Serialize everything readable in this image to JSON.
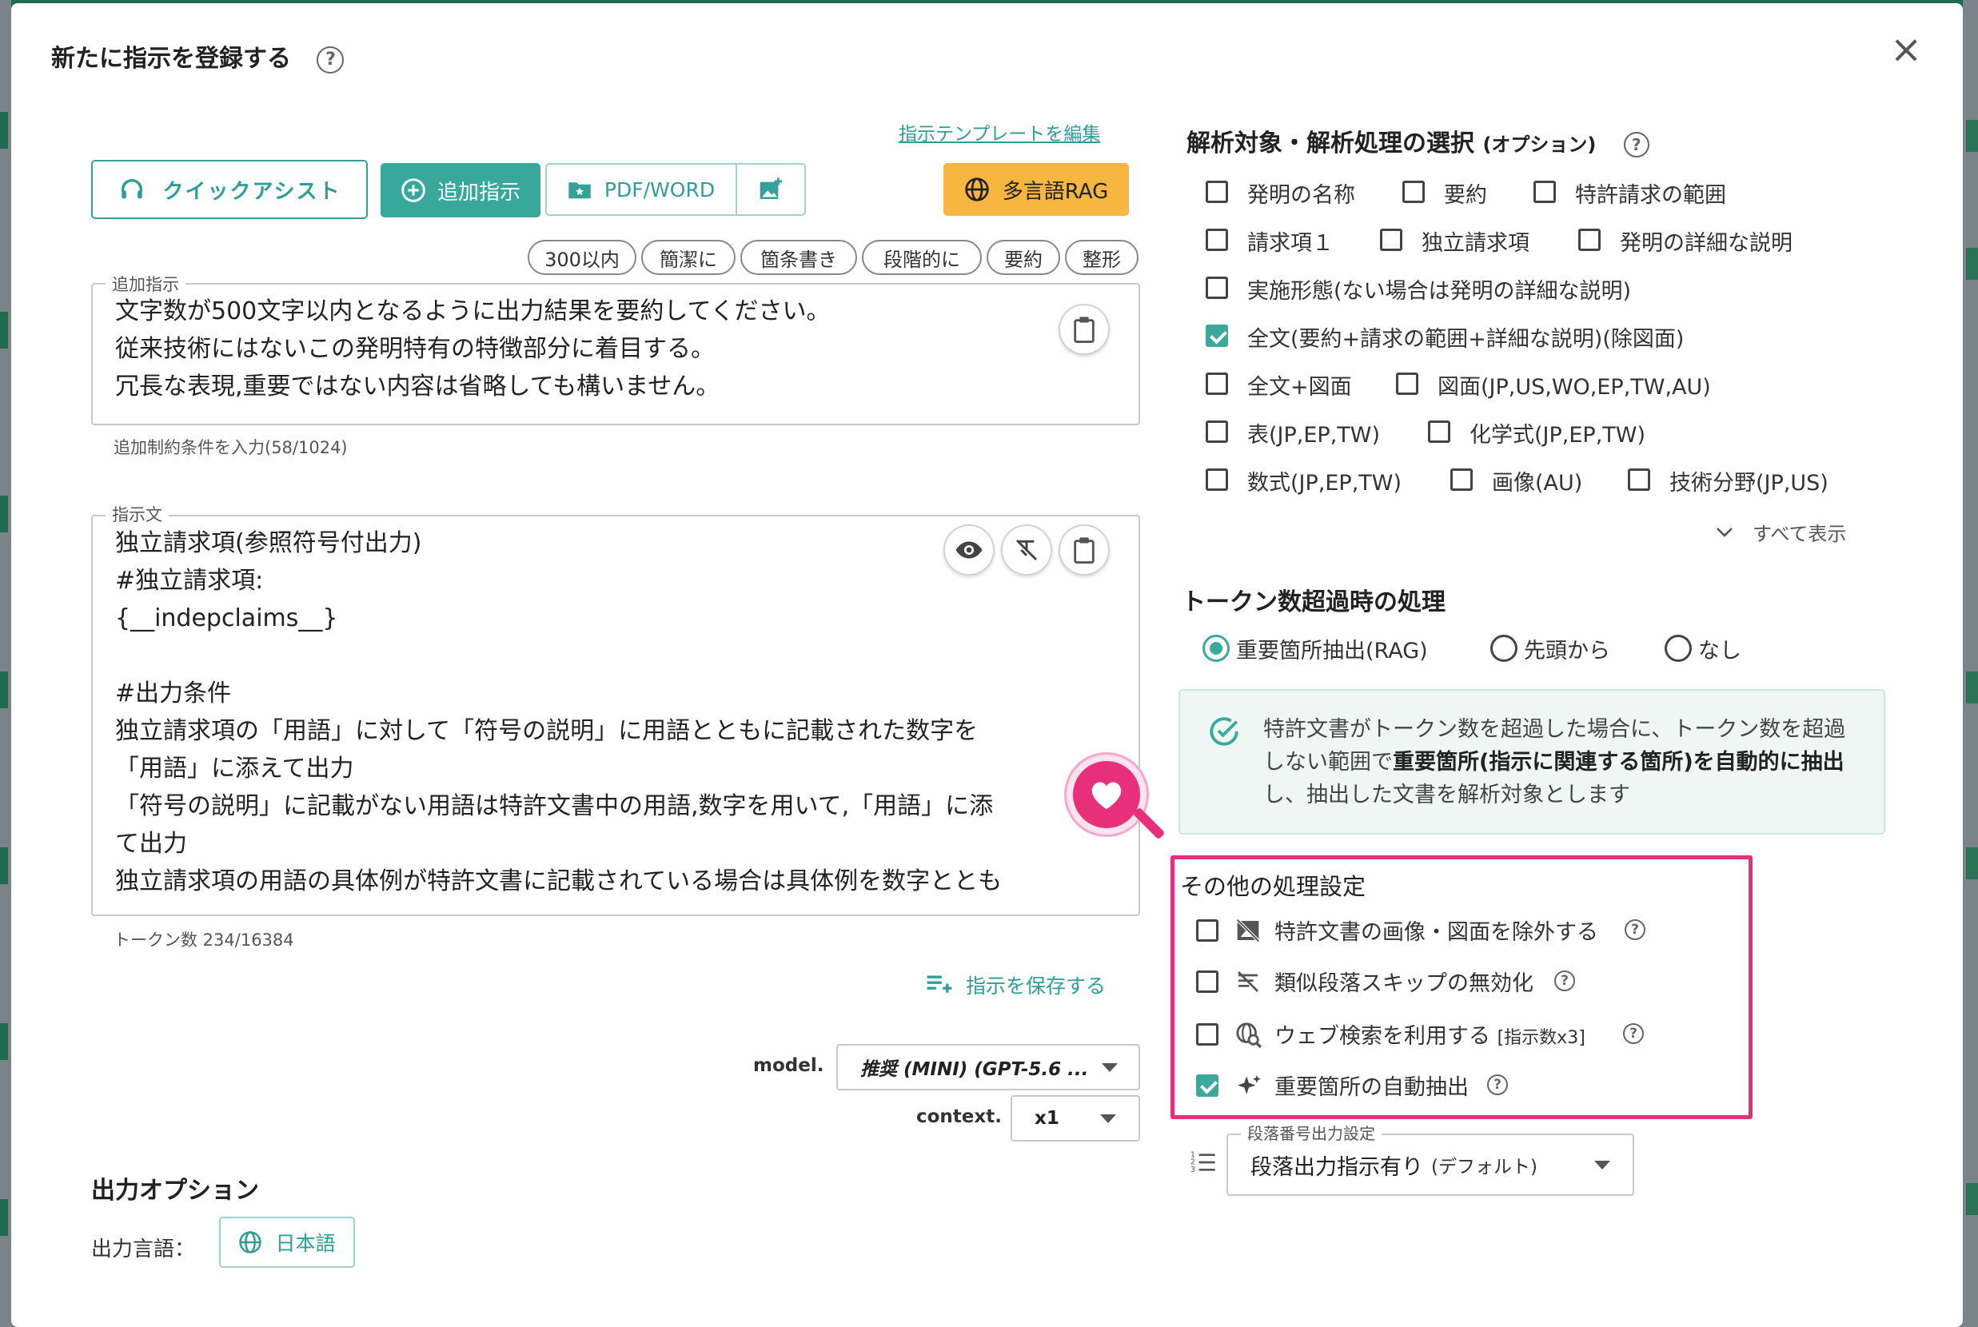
{
  "dialog": {
    "title": "新たに指示を登録する",
    "close_label": "×"
  },
  "left": {
    "edit_template_link": "指示テンプレートを編集",
    "quick_assist_label": "クイックアシスト",
    "add_instruction_label": "追加指示",
    "pdf_word_label": "PDF/WORD",
    "multilang_rag_label": "多言語RAG",
    "chips": [
      "300以内",
      "簡潔に",
      "箇条書き",
      "段階的に",
      "要約",
      "整形"
    ],
    "additional": {
      "label": "追加指示",
      "lines": [
        "文字数が500文字以内となるように出力結果を要約してください。",
        "従来技術にはないこの発明特有の特徴部分に着目する。",
        "冗長な表現,重要ではない内容は省略しても構いません。"
      ],
      "helper": "追加制約条件を入力(58/1024)"
    },
    "instruction": {
      "label": "指示文",
      "lines": [
        "独立請求項(参照符号付出力)",
        "#独立請求項:",
        "{__indepclaims__}",
        "",
        "#出力条件",
        "独立請求項の「用語」に対して「符号の説明」に用語とともに記載された数字を",
        "「用語」に添えて出力",
        "「符号の説明」に記載がない用語は特許文書中の用語,数字を用いて,「用語」に添",
        "て出力",
        "独立請求項の用語の具体例が特許文書に記載されている場合は具体例を数字ととも"
      ],
      "helper": "トークン数 234/16384"
    },
    "save_instruction_label": "指示を保存する",
    "model_label": "model.",
    "model_value": "推奨 (MINI) (GPT-5.6 ...",
    "context_label": "context.",
    "context_value": "x1",
    "output_options_title": "出力オプション",
    "output_language_label": "出力言語：",
    "output_language_value": "日本語"
  },
  "right": {
    "analysis_title": "解析対象・解析処理の選択",
    "analysis_title_suffix": "(オプション)",
    "targets": [
      {
        "label": "発明の名称",
        "checked": false
      },
      {
        "label": "要約",
        "checked": false
      },
      {
        "label": "特許請求の範囲",
        "checked": false
      },
      {
        "label": "請求項１",
        "checked": false
      },
      {
        "label": "独立請求項",
        "checked": false
      },
      {
        "label": "発明の詳細な説明",
        "checked": false
      },
      {
        "label": "実施形態(ない場合は発明の詳細な説明)",
        "checked": false
      },
      {
        "label": "全文(要約+請求の範囲+詳細な説明)(除図面)",
        "checked": true
      },
      {
        "label": "全文+図面",
        "checked": false
      },
      {
        "label": "図面(JP,US,WO,EP,TW,AU)",
        "checked": false
      },
      {
        "label": "表(JP,EP,TW)",
        "checked": false
      },
      {
        "label": "化学式(JP,EP,TW)",
        "checked": false
      },
      {
        "label": "数式(JP,EP,TW)",
        "checked": false
      },
      {
        "label": "画像(AU)",
        "checked": false
      },
      {
        "label": "技術分野(JP,US)",
        "checked": false
      }
    ],
    "show_all_label": "すべて表示",
    "token_title": "トークン数超過時の処理",
    "token_options": [
      {
        "label": "重要箇所抽出(RAG)",
        "selected": true
      },
      {
        "label": "先頭から",
        "selected": false
      },
      {
        "label": "なし",
        "selected": false
      }
    ],
    "info_pre": "特許文書がトークン数を超過した場合に、トークン数を超過しない範囲で",
    "info_bold": "重要箇所(指示に関連する箇所)を自動的に抽出",
    "info_post": "し、抽出した文書を解析対象とします",
    "other_title": "その他の処理設定",
    "other_options": [
      {
        "label": "特許文書の画像・図面を除外する",
        "checked": false,
        "icon": "no-image-icon"
      },
      {
        "label": "類似段落スキップの無効化",
        "checked": false,
        "icon": "skip-off-icon"
      },
      {
        "label": "ウェブ検索を利用する",
        "note": "[指示数x3]",
        "checked": false,
        "icon": "web-search-icon"
      },
      {
        "label": "重要箇所の自動抽出",
        "checked": true,
        "icon": "sparkle-icon"
      }
    ],
    "paragraph_label": "段落番号出力設定",
    "paragraph_value": "段落出力指示有り",
    "paragraph_suffix": "(デフォルト)"
  },
  "colors": {
    "accent": "#38a89d",
    "highlight": "#e8307a",
    "orange": "#f6b63f"
  }
}
